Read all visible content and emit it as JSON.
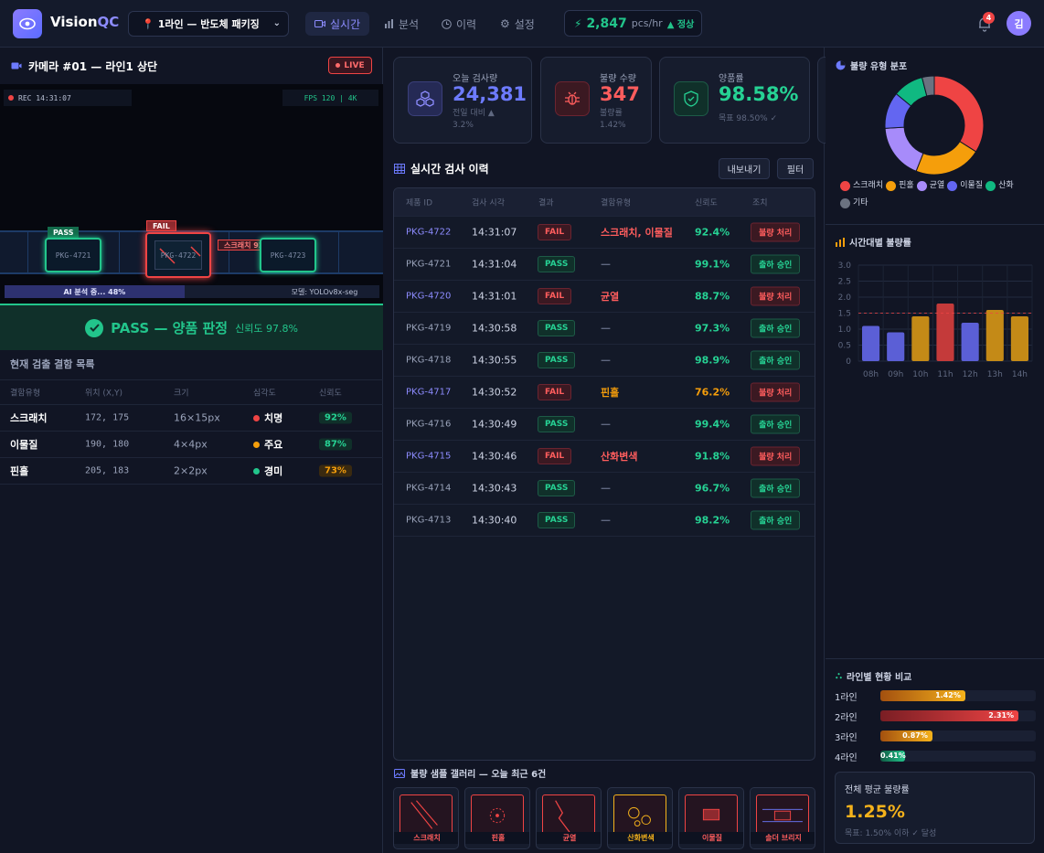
{
  "brand": {
    "name_a": "Vision",
    "name_b": "QC"
  },
  "line_select": {
    "value": "1라인 — 반도체 패키징"
  },
  "nav": [
    {
      "label": "실시간",
      "active": true
    },
    {
      "label": "분석",
      "active": false
    },
    {
      "label": "이력",
      "active": false
    },
    {
      "label": "설정",
      "active": false
    }
  ],
  "throughput": {
    "value": "2,847",
    "unit": "pcs/hr",
    "status": "▲ 정상"
  },
  "notifications": {
    "count": "4"
  },
  "user": {
    "initial": "김"
  },
  "camera": {
    "title": "카메라 #01 — 라인1 상단",
    "live": "LIVE",
    "rec": "REC  14:31:07",
    "fps": "FPS 120  |  4K",
    "packages": [
      {
        "id": "PKG-4721",
        "tag": "PASS"
      },
      {
        "id": "PKG-4722",
        "tag": "FAIL",
        "annotation": "스크래치 92"
      },
      {
        "id": "PKG-4723",
        "tag": ""
      }
    ],
    "ai_progress": "AI 분석 중... 48%",
    "ai_progress_fraction": 0.48,
    "model": "모델: YOLOv8x-seg"
  },
  "verdict": {
    "text": "PASS — 양품 판정",
    "confidence": "신뢰도 97.8%"
  },
  "detections": {
    "title": "현재 검출 결함 목록",
    "headers": [
      "결함유형",
      "위치 (X,Y)",
      "크기",
      "심각도",
      "신뢰도"
    ],
    "rows": [
      {
        "type": "스크래치",
        "pos": "172, 175",
        "size": "16×15px",
        "severity": "치명",
        "sev_color": "#ef4444",
        "conf": "92%",
        "conf_color": "#26d294",
        "conf_bg": "#10302a"
      },
      {
        "type": "이물질",
        "pos": "190, 180",
        "size": "4×4px",
        "severity": "주요",
        "sev_color": "#f59e0b",
        "conf": "87%",
        "conf_color": "#26d294",
        "conf_bg": "#10302a"
      },
      {
        "type": "핀홀",
        "pos": "205, 183",
        "size": "2×2px",
        "severity": "경미",
        "sev_color": "#22c58b",
        "conf": "73%",
        "conf_color": "#f59e0b",
        "conf_bg": "#3a2a10"
      }
    ]
  },
  "stats": [
    {
      "label": "오늘 검사량",
      "value": "24,381",
      "sub1": "전일 대비 ▲",
      "sub2": "3.2%",
      "color": "#6d7bff",
      "icon": "boxes-icon"
    },
    {
      "label": "불량 수량",
      "value": "347",
      "sub1": "불량률",
      "sub2": "1.42%",
      "color": "#ff5d5d",
      "icon": "bug-icon"
    },
    {
      "label": "양품률",
      "value": "98.58%",
      "sub1": "목표 98.50% ✓",
      "sub2": "",
      "color": "#26d294",
      "icon": "shield-check-icon"
    }
  ],
  "history": {
    "title": "실시간 검사 이력",
    "export_label": "내보내기",
    "filter_label": "필터",
    "headers": [
      "제품 ID",
      "검사 시각",
      "결과",
      "결함유형",
      "신뢰도",
      "조치"
    ],
    "rows": [
      {
        "id": "PKG-4722",
        "time": "14:31:07",
        "result": "FAIL",
        "defect": "스크래치, 이물질",
        "conf": "92.4%",
        "action": "불량 처리"
      },
      {
        "id": "PKG-4721",
        "time": "14:31:04",
        "result": "PASS",
        "defect": "—",
        "conf": "99.1%",
        "action": "출하 승인"
      },
      {
        "id": "PKG-4720",
        "time": "14:31:01",
        "result": "FAIL",
        "defect": "균열",
        "conf": "88.7%",
        "action": "불량 처리"
      },
      {
        "id": "PKG-4719",
        "time": "14:30:58",
        "result": "PASS",
        "defect": "—",
        "conf": "97.3%",
        "action": "출하 승인"
      },
      {
        "id": "PKG-4718",
        "time": "14:30:55",
        "result": "PASS",
        "defect": "—",
        "conf": "98.9%",
        "action": "출하 승인"
      },
      {
        "id": "PKG-4717",
        "time": "14:30:52",
        "result": "FAIL",
        "defect": "핀홀",
        "conf": "76.2%",
        "action": "불량 처리"
      },
      {
        "id": "PKG-4716",
        "time": "14:30:49",
        "result": "PASS",
        "defect": "—",
        "conf": "99.4%",
        "action": "출하 승인"
      },
      {
        "id": "PKG-4715",
        "time": "14:30:46",
        "result": "FAIL",
        "defect": "산화변색",
        "conf": "91.8%",
        "action": "불량 처리"
      },
      {
        "id": "PKG-4714",
        "time": "14:30:43",
        "result": "PASS",
        "defect": "—",
        "conf": "96.7%",
        "action": "출하 승인"
      },
      {
        "id": "PKG-4713",
        "time": "14:30:40",
        "result": "PASS",
        "defect": "—",
        "conf": "98.2%",
        "action": "출하 승인"
      }
    ]
  },
  "gallery": {
    "title": "불량 샘플 갤러리 — 오늘 최근 6건",
    "items": [
      "스크래치",
      "핀홀",
      "균열",
      "산화변색",
      "이물질",
      "솔더 브리지"
    ]
  },
  "chart_data": [
    {
      "type": "pie",
      "title": "불량 유형 분포",
      "categories": [
        "스크래치",
        "핀홀",
        "균열",
        "이물질",
        "산화",
        "기타"
      ],
      "values": [
        34,
        22,
        18,
        12,
        10,
        4
      ],
      "colors": [
        "#ef4444",
        "#f59e0b",
        "#a78bfa",
        "#6366f1",
        "#10b981",
        "#6b7280"
      ]
    },
    {
      "type": "bar",
      "title": "시간대별 불량률",
      "categories": [
        "08h",
        "09h",
        "10h",
        "11h",
        "12h",
        "13h",
        "14h"
      ],
      "values": [
        1.1,
        0.9,
        1.4,
        1.8,
        1.2,
        1.6,
        1.4
      ],
      "colors": [
        "#5b5fd6",
        "#5b5fd6",
        "#c48a17",
        "#c43a3a",
        "#5b5fd6",
        "#c48a17",
        "#c48a17"
      ],
      "yticks": [
        "3.0",
        "2.5",
        "2.0",
        "1.5",
        "1.0",
        "0.5",
        "0"
      ],
      "ylim": [
        0,
        3.0
      ],
      "threshold": 1.5
    }
  ],
  "line_compare": {
    "title": "라인별 현황 비교",
    "rows": [
      {
        "line": "1라인",
        "label": "1.42%",
        "value": 1.42,
        "color": "linear-gradient(90deg,#a3500f,#f5b21b)"
      },
      {
        "line": "2라인",
        "label": "2.31%",
        "value": 2.31,
        "color": "linear-gradient(90deg,#7a1e24,#ef4444)"
      },
      {
        "line": "3라인",
        "label": "0.87%",
        "value": 0.87,
        "color": "linear-gradient(90deg,#a3500f,#f5b21b)"
      },
      {
        "line": "4라인",
        "label": "0.41%",
        "value": 0.41,
        "color": "linear-gradient(90deg,#0f5a43,#22c58b)"
      }
    ],
    "max": 2.6
  },
  "average": {
    "title": "전체 평균 불량률",
    "value": "1.25%",
    "target": "목표: 1.50% 이하 ✓ 달성"
  }
}
